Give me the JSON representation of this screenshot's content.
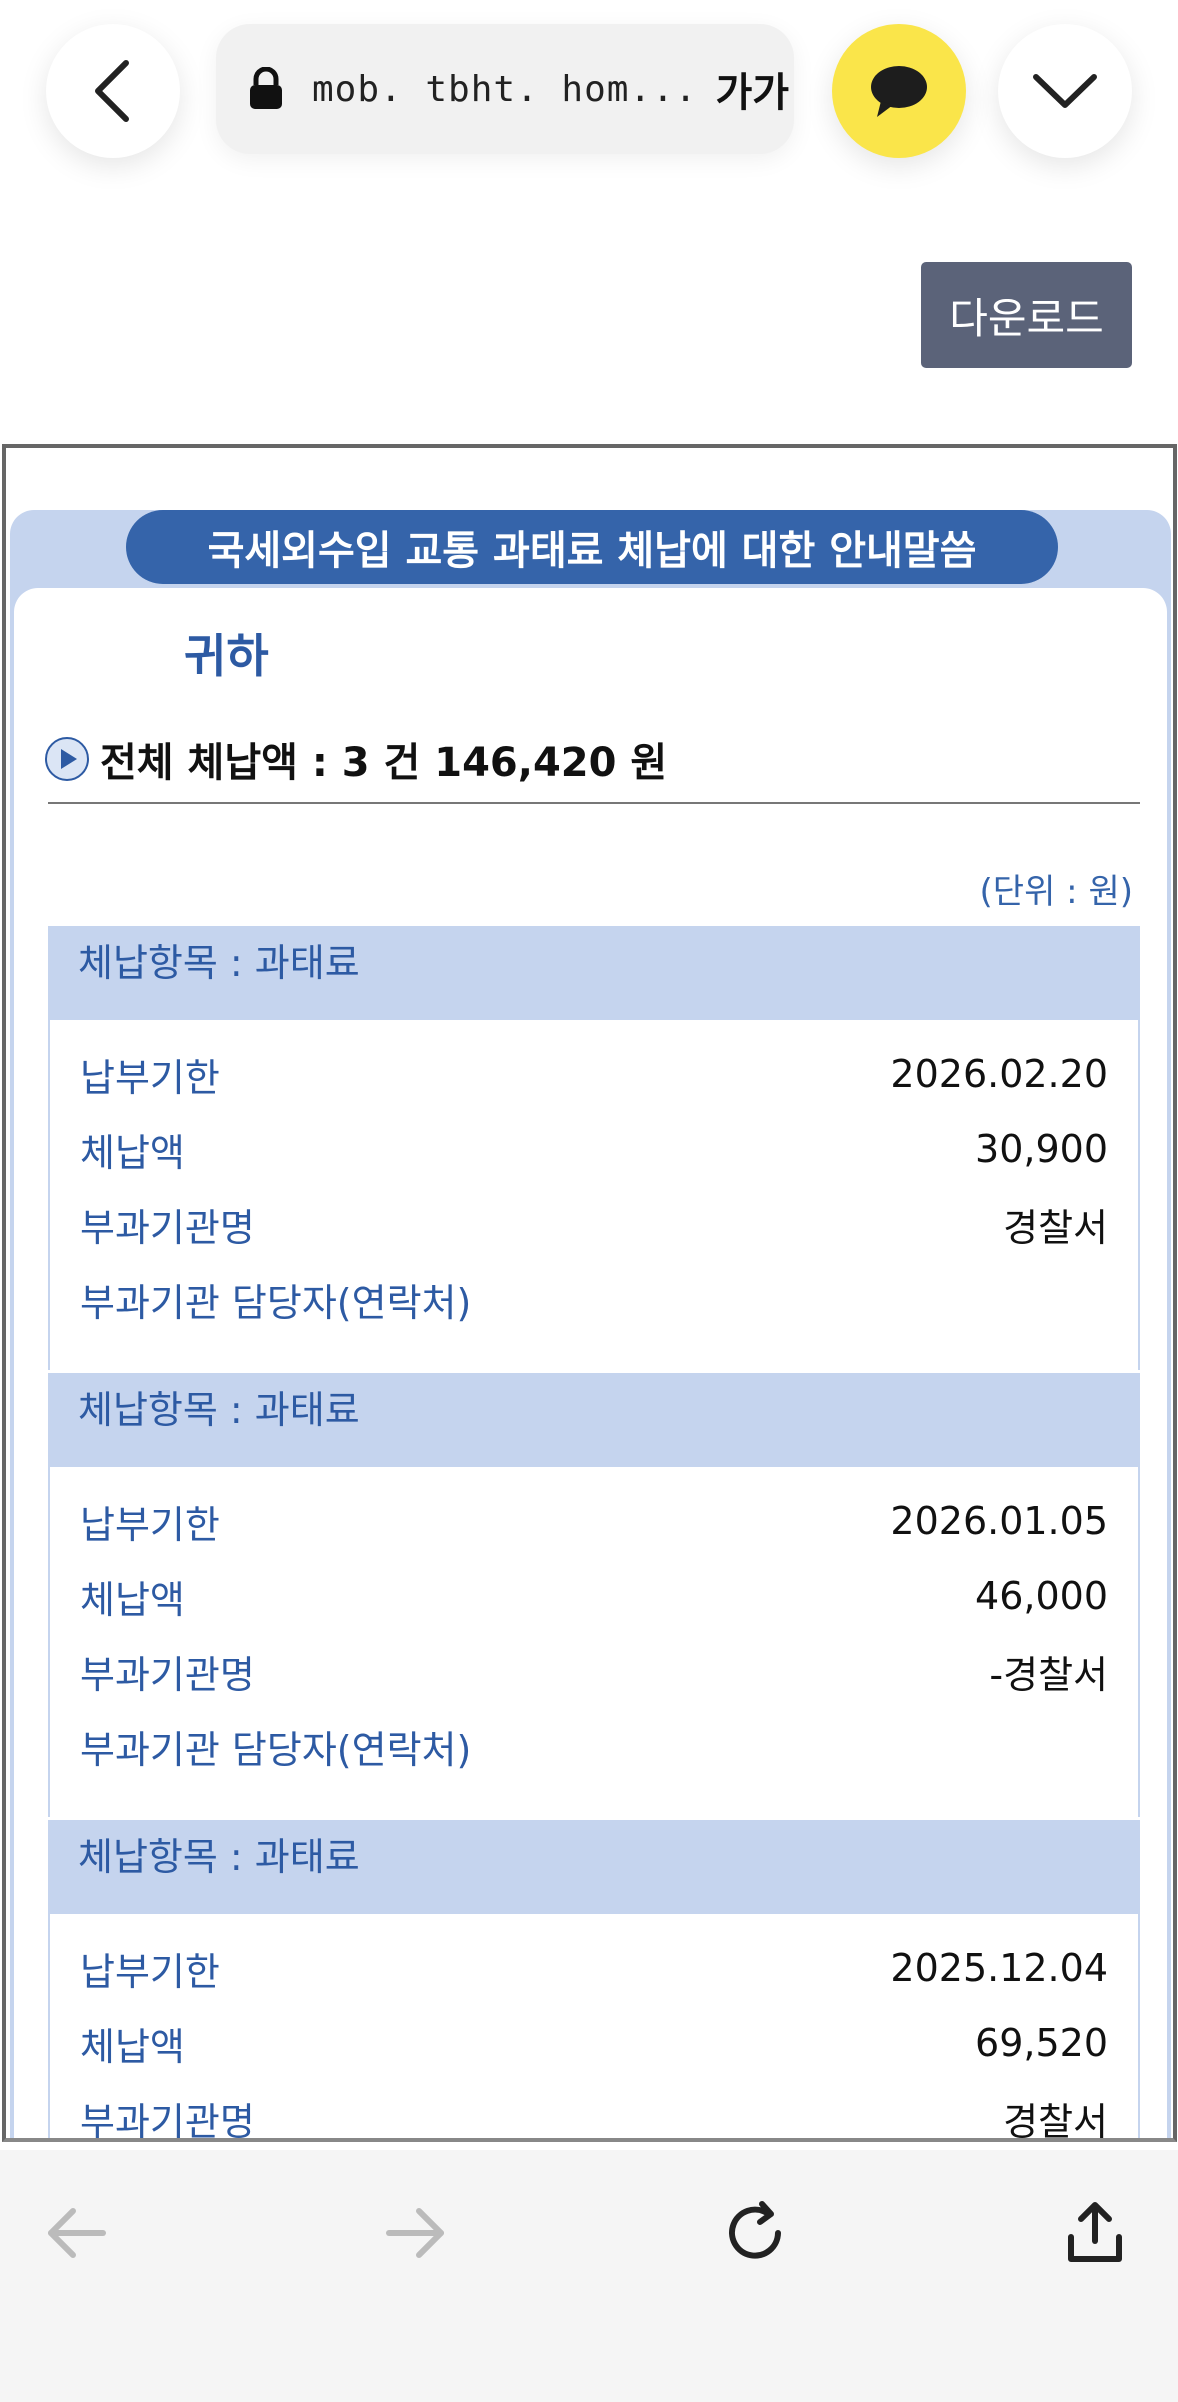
{
  "browser": {
    "url": "mob. tbht. hom...",
    "font_size_label": "가가"
  },
  "download_label": "다운로드",
  "notice": {
    "title": "국세외수입 교통 과태료 체납에 대한 안내말씀",
    "recipient": "귀하",
    "total": "전체 체납액 : 3 건 146,420 원",
    "unit": "(단위 : 원)"
  },
  "items": [
    {
      "header": "체납항목 : 과태료",
      "rows": [
        {
          "label": "납부기한",
          "value": "2026.02.20"
        },
        {
          "label": "체납액",
          "value": "30,900"
        },
        {
          "label": "부과기관명",
          "value": "경찰서"
        },
        {
          "label": "부과기관 담당자(연락처)",
          "value": ""
        }
      ]
    },
    {
      "header": "체납항목 : 과태료",
      "rows": [
        {
          "label": "납부기한",
          "value": "2026.01.05"
        },
        {
          "label": "체납액",
          "value": "46,000"
        },
        {
          "label": "부과기관명",
          "value": "-경찰서"
        },
        {
          "label": "부과기관 담당자(연락처)",
          "value": ""
        }
      ]
    },
    {
      "header": "체납항목 : 과태료",
      "rows": [
        {
          "label": "납부기한",
          "value": "2025.12.04"
        },
        {
          "label": "체납액",
          "value": "69,520"
        },
        {
          "label": "부과기관명",
          "value": "경찰서"
        }
      ]
    }
  ],
  "icons": {
    "back": "chevron-left-icon",
    "lock": "lock-icon",
    "kakao": "speech-bubble-icon",
    "menu": "chevron-down-icon",
    "nav_back": "arrow-left-icon",
    "nav_forward": "arrow-right-icon",
    "refresh": "refresh-icon",
    "share": "share-icon"
  },
  "colors": {
    "accent": "#3564aa",
    "header_bg": "#c5d4ee",
    "kakao_yellow": "#fae54a",
    "download_bg": "#5b6379"
  }
}
